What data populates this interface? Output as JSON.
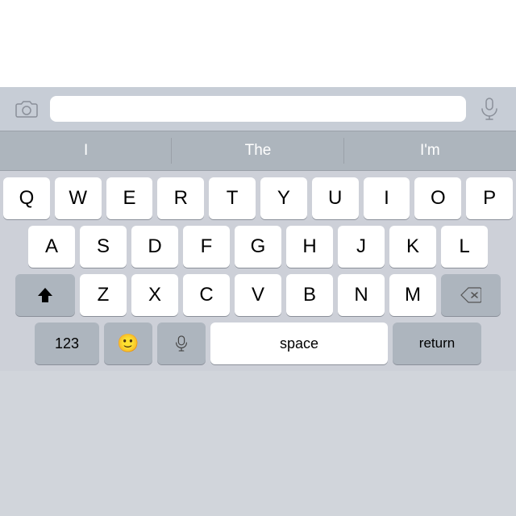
{
  "topArea": {
    "background": "#ffffff"
  },
  "inputBar": {
    "placeholder": "",
    "cameraIconLabel": "camera-icon",
    "micIconLabel": "mic-icon"
  },
  "suggestions": [
    {
      "label": "I"
    },
    {
      "label": "The"
    },
    {
      "label": "I'm"
    }
  ],
  "keyboard": {
    "rows": [
      [
        "Q",
        "W",
        "E",
        "R",
        "T",
        "Y",
        "U",
        "I",
        "O",
        "P"
      ],
      [
        "A",
        "S",
        "D",
        "F",
        "G",
        "H",
        "J",
        "K",
        "L"
      ],
      [
        "Z",
        "X",
        "C",
        "V",
        "B",
        "N",
        "M"
      ]
    ],
    "specialKeys": {
      "shift": "⬆",
      "delete": "⌫",
      "numbers": "123",
      "emoji": "😊",
      "mic": "🎤",
      "space": "space",
      "return": "return"
    }
  }
}
